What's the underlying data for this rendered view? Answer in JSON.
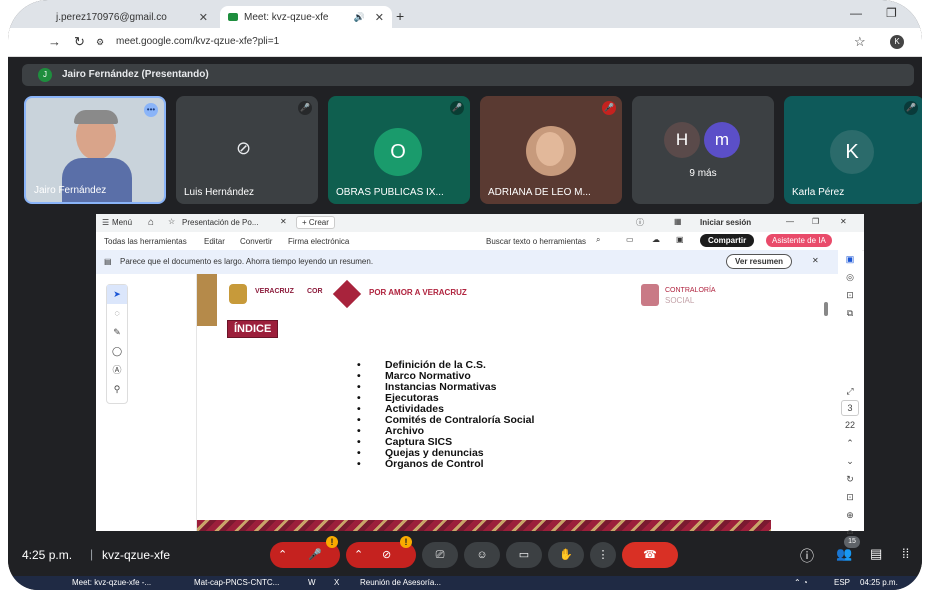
{
  "browser": {
    "tab_inactive": "j.perez170976@gmail.co",
    "tab_active": "Meet: kvz-qzue-xfe",
    "url": "meet.google.com/kvz-qzue-xfe?pli=1",
    "profile_initial": "K"
  },
  "meet": {
    "presenter_initial": "J",
    "presenter_label": "Jairo Fernández (Presentando)",
    "tiles": [
      {
        "name": "Jairo Fernández",
        "type": "video"
      },
      {
        "name": "Luis Hernández",
        "type": "camera-off"
      },
      {
        "name": "OBRAS PUBLICAS IX...",
        "initial": "O",
        "color": "#1a7f5a"
      },
      {
        "name": "ADRIANA DE LEO M...",
        "type": "photo"
      },
      {
        "name": "9 más",
        "initials": [
          "H",
          "m"
        ]
      },
      {
        "name": "Karla Pérez",
        "initial": "K"
      }
    ],
    "time": "4:25 p.m.",
    "meeting_code": "kvz-qzue-xfe",
    "participants_badge": "15",
    "warning_mark": "!"
  },
  "pdf": {
    "menu": "Menú",
    "tab_title": "Presentación de Po...",
    "new_tab": "+ Crear",
    "signin": "Iniciar sesión",
    "tools": [
      "Todas las herramientas",
      "Editar",
      "Convertir",
      "Firma electrónica"
    ],
    "search": "Buscar texto o herramientas",
    "share": "Compartir",
    "ai": "Asistente de IA",
    "notice": "Parece que el documento es largo. Ahorra tiempo leyendo un resumen.",
    "summary_btn": "Ver resumen",
    "page_current": "3",
    "page_total": "22"
  },
  "slide": {
    "logo1": "VERACRUZ",
    "logo2": "COR",
    "logo3": "POR AMOR A VERACRUZ",
    "logo4_top": "CONTRALORÍA",
    "logo4_bottom": "SOCIAL",
    "heading": "ÍNDICE",
    "items": [
      "Definición de la C.S.",
      "Marco Normativo",
      "Instancias Normativas",
      "Ejecutoras",
      "Actividades",
      "Comités de Contraloría Social",
      "Archivo",
      "Captura SICS",
      "Quejas y denuncias",
      "Órganos de Control"
    ]
  },
  "taskbar": {
    "items": [
      "Meet: kvz-qzue-xfe -...",
      "Mat-cap-PNCS-CNTC...",
      "Reunión de Asesoría..."
    ],
    "lang": "ESP",
    "clock": "04:25 p.m."
  }
}
